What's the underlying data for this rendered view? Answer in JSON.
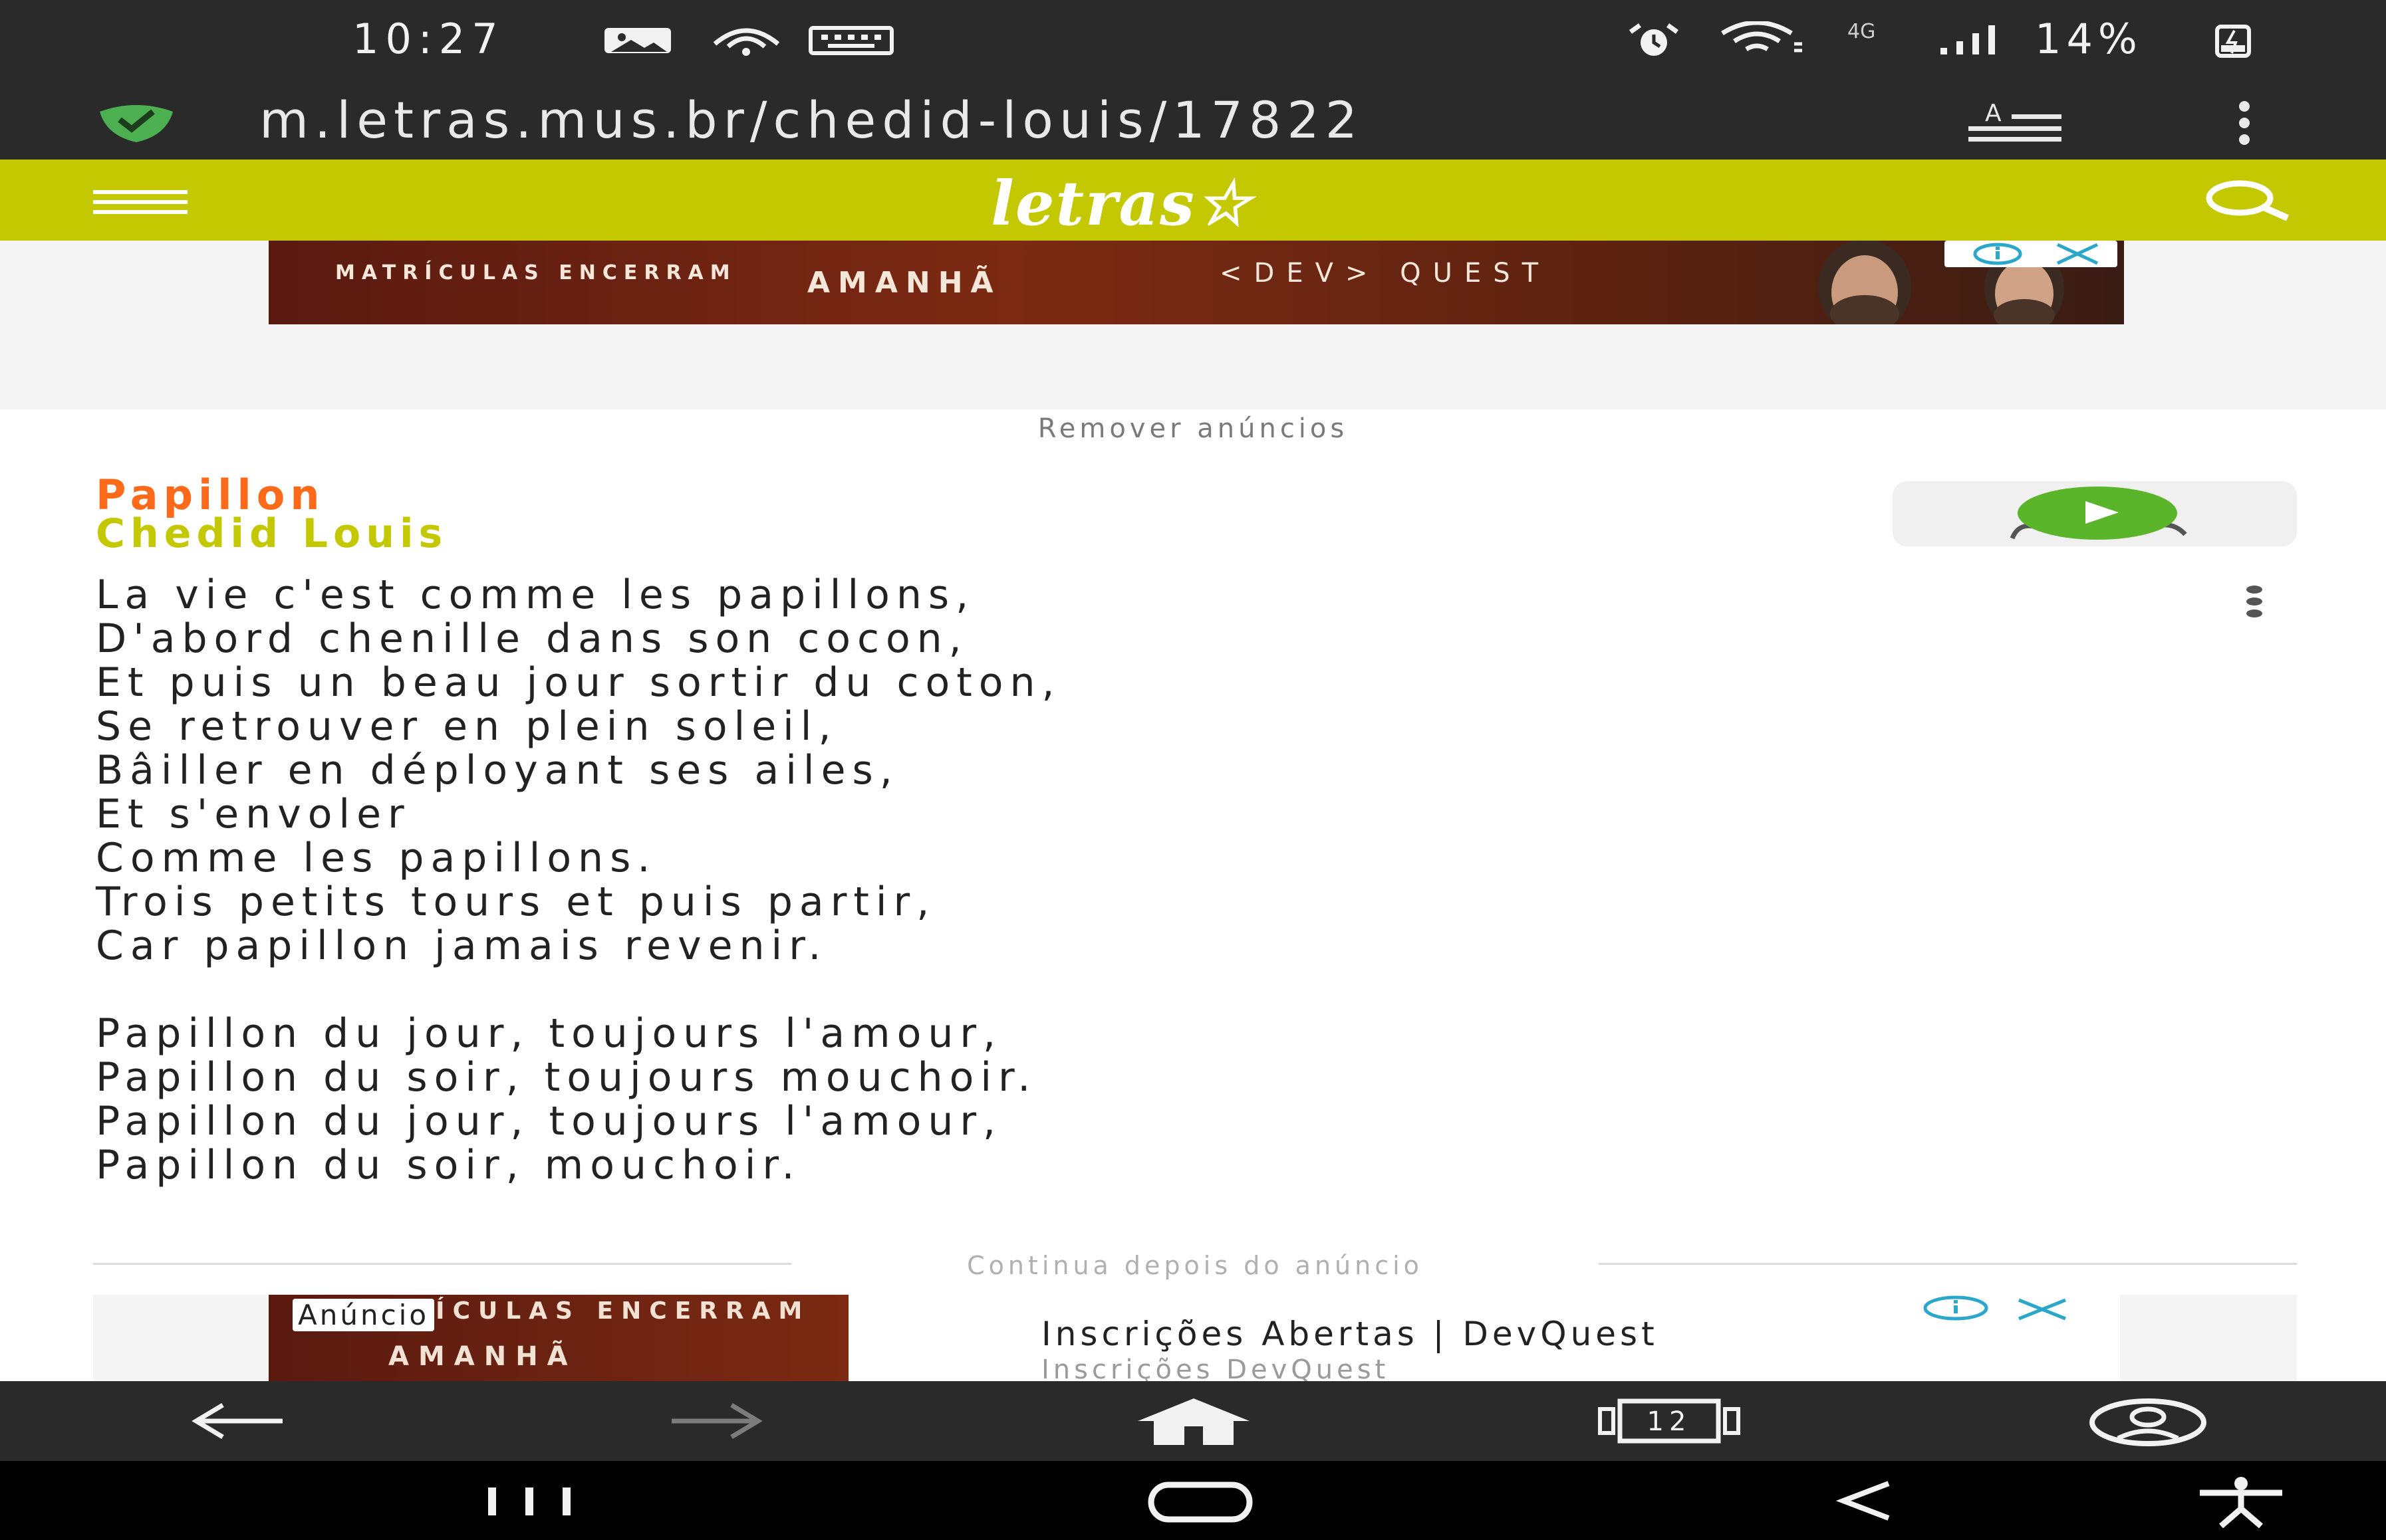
{
  "status_bar": {
    "time": "10:27",
    "network": "4G",
    "battery": "14%",
    "icons": [
      "gallery-icon",
      "cast-icon",
      "keyboard-icon",
      "alarm-icon",
      "wifi-icon",
      "signal-icon",
      "battery-icon"
    ]
  },
  "url_bar": {
    "url": "m.letras.mus.br/chedid-louis/17822",
    "icons": [
      "shield-check-icon",
      "reader-mode-icon",
      "more-vertical-icon"
    ]
  },
  "site_header": {
    "logo": "letras",
    "icons": [
      "hamburger-menu-icon",
      "search-icon"
    ]
  },
  "top_ad": {
    "line1": "MATRÍCULAS ENCERRAM",
    "line2": "AMANHÃ",
    "line3": "<DEV> QUEST",
    "remove_ads": "Remover anúncios"
  },
  "song": {
    "title": "Papillon",
    "artist": "Chedid Louis",
    "lyrics": "La vie c'est comme les papillons,\nD'abord chenille dans son cocon,\nEt puis un beau jour sortir du coton,\nSe retrouver en plein soleil,\nBâiller en déployant ses ailes,\nEt s'envoler\nComme les papillons.\nTrois petits tours et puis partir,\nCar papillon jamais revenir.\n\nPapillon du jour, toujours l'amour,\nPapillon du soir, toujours mouchoir.\nPapillon du jour, toujours l'amour,\nPapillon du soir, mouchoir."
  },
  "divider_text": "Continua depois do anúncio",
  "bottom_ad": {
    "badge": "Anúncio",
    "image_line1": "MATRÍCULAS ENCERRAM",
    "image_line2": "AMANHÃ",
    "headline": "Inscrições Abertas | DevQuest",
    "subline": "Inscrições DevQuest"
  },
  "browser_nav": {
    "tabs_count": "12",
    "icons": [
      "back-arrow-icon",
      "forward-arrow-icon",
      "home-icon",
      "tabs-icon",
      "account-icon"
    ]
  },
  "colors": {
    "header_bg": "#c3c800",
    "title": "#ff6a1a",
    "artist": "#c3c800",
    "play_green": "#5bb52a",
    "chrome_bg": "#2a2a2a"
  }
}
